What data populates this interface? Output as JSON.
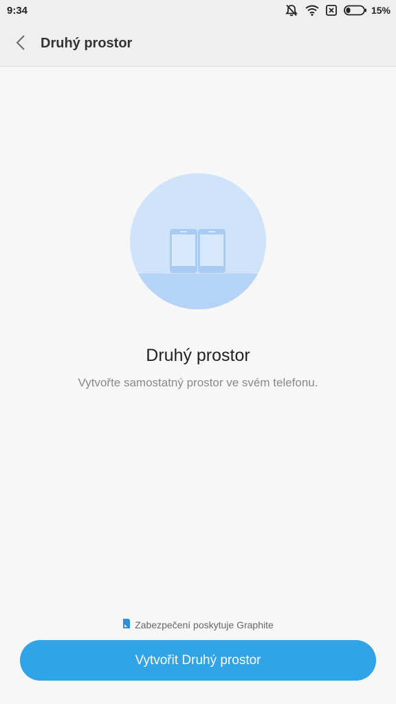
{
  "status_bar": {
    "time": "9:34",
    "battery_percent": "15%",
    "icons": [
      "mute-icon",
      "wifi-icon",
      "no-sim-icon",
      "battery-icon"
    ]
  },
  "app_bar": {
    "back_icon": "chevron-left-icon",
    "title": "Druhý prostor"
  },
  "main": {
    "illustration": "dual-phone-illustration",
    "heading": "Druhý prostor",
    "subheading": "Vytvořte samostatný prostor ve svém telefonu."
  },
  "footer": {
    "security_note": "Zabezpečení poskytuje Graphite",
    "security_icon": "graphite-icon",
    "create_button": "Vytvořit Druhý prostor"
  },
  "colors": {
    "accent": "#31a3e7",
    "background": "#f7f7f7",
    "illustration_light": "#cfe3fb",
    "illustration_dark": "#b4d3f6"
  }
}
